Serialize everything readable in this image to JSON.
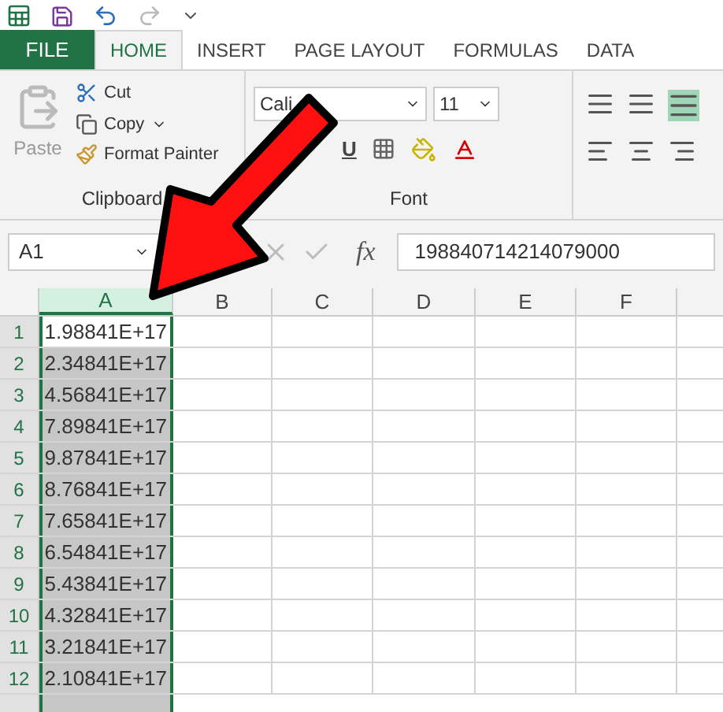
{
  "tabs": [
    {
      "label": "FILE",
      "selected": false,
      "kind": "file"
    },
    {
      "label": "HOME",
      "selected": true,
      "kind": "tab"
    },
    {
      "label": "INSERT",
      "selected": false,
      "kind": "tab"
    },
    {
      "label": "PAGE LAYOUT",
      "selected": false,
      "kind": "tab"
    },
    {
      "label": "FORMULAS",
      "selected": false,
      "kind": "tab"
    },
    {
      "label": "DATA",
      "selected": false,
      "kind": "tab"
    }
  ],
  "clipboard": {
    "paste": "Paste",
    "cut": "Cut",
    "copy": "Copy",
    "format_painter": "Format Painter",
    "label": "Clipboard"
  },
  "font": {
    "name": "Cali",
    "size": "11",
    "label": "Font",
    "underline": "U"
  },
  "formula_bar": {
    "name_box": "A1",
    "fx": "fx",
    "value": "198840714214079000"
  },
  "columns": [
    {
      "label": "A",
      "selected": true
    },
    {
      "label": "B",
      "selected": false
    },
    {
      "label": "C",
      "selected": false
    },
    {
      "label": "D",
      "selected": false
    },
    {
      "label": "E",
      "selected": false
    },
    {
      "label": "F",
      "selected": false
    }
  ],
  "rows": [
    {
      "number": "1",
      "value": "1.98841E+17",
      "selected": true,
      "active": true
    },
    {
      "number": "2",
      "value": "2.34841E+17",
      "selected": true,
      "active": false
    },
    {
      "number": "3",
      "value": "4.56841E+17",
      "selected": true,
      "active": false
    },
    {
      "number": "4",
      "value": "7.89841E+17",
      "selected": true,
      "active": false
    },
    {
      "number": "5",
      "value": "9.87841E+17",
      "selected": true,
      "active": false
    },
    {
      "number": "6",
      "value": "8.76841E+17",
      "selected": true,
      "active": false
    },
    {
      "number": "7",
      "value": "7.65841E+17",
      "selected": true,
      "active": false
    },
    {
      "number": "8",
      "value": "6.54841E+17",
      "selected": true,
      "active": false
    },
    {
      "number": "9",
      "value": "5.43841E+17",
      "selected": true,
      "active": false
    },
    {
      "number": "10",
      "value": "4.32841E+17",
      "selected": true,
      "active": false
    },
    {
      "number": "11",
      "value": "3.21841E+17",
      "selected": true,
      "active": false
    },
    {
      "number": "12",
      "value": "2.10841E+17",
      "selected": true,
      "active": false
    }
  ]
}
